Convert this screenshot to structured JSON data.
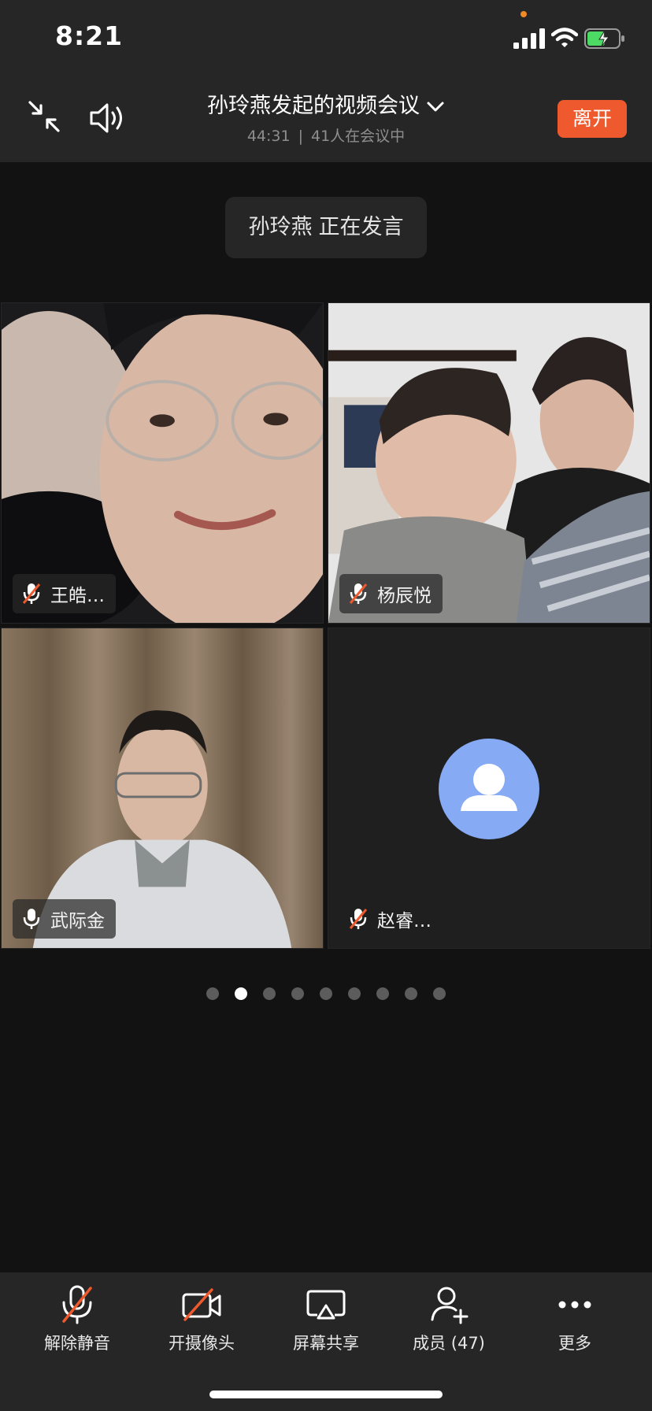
{
  "status_bar": {
    "time": "8:21"
  },
  "header": {
    "title": "孙玲燕发起的视频会议",
    "duration": "44:31",
    "separator": "|",
    "participants_text": "41人在会议中",
    "leave_label": "离开"
  },
  "speaking": {
    "name": "孙玲燕",
    "status": "正在发言"
  },
  "tiles": [
    {
      "name": "王皓…",
      "muted": true
    },
    {
      "name": "杨辰悦",
      "muted": true
    },
    {
      "name": "武际金",
      "muted": false
    },
    {
      "name": "赵睿…",
      "muted": true,
      "video": false
    }
  ],
  "pagination": {
    "total_pages": 9,
    "current_page": 2
  },
  "toolbar": {
    "unmute_label": "解除静音",
    "camera_label": "开摄像头",
    "share_label": "屏幕共享",
    "members_label": "成员 (47)",
    "more_label": "更多"
  },
  "colors": {
    "background": "#121212",
    "bar": "#262626",
    "leave_button": "#ee5a2d",
    "avatar": "#86aaf4",
    "mute_slash": "#ee5a2d"
  }
}
